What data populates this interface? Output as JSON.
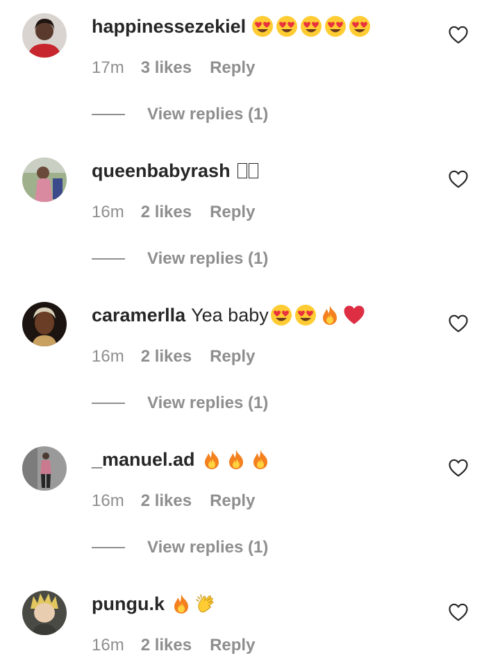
{
  "comments": [
    {
      "username": "happinessezekiel",
      "message": "",
      "emoji": [
        "heart-eyes",
        "heart-eyes",
        "heart-eyes",
        "heart-eyes",
        "heart-eyes"
      ],
      "time": "17m",
      "likes": "3 likes",
      "reply": "Reply",
      "view_replies": "View replies (1)",
      "avatar_color": "#b23a3a"
    },
    {
      "username": "queenbabyrash",
      "message": "",
      "emoji": [
        "missing-glyph",
        "missing-glyph"
      ],
      "time": "16m",
      "likes": "2 likes",
      "reply": "Reply",
      "view_replies": "View replies (1)",
      "avatar_color": "#8a9a7a"
    },
    {
      "username": "caramerlla",
      "message": "Yea baby",
      "emoji": [
        "heart-eyes",
        "heart-eyes",
        "fire",
        "red-heart"
      ],
      "time": "16m",
      "likes": "2 likes",
      "reply": "Reply",
      "view_replies": "View replies (1)",
      "avatar_color": "#3a2a22"
    },
    {
      "username": "_manuel.ad",
      "message": "",
      "emoji": [
        "fire",
        "fire",
        "fire"
      ],
      "time": "16m",
      "likes": "2 likes",
      "reply": "Reply",
      "view_replies": "View replies (1)",
      "avatar_color": "#8c8c8c"
    },
    {
      "username": "pungu.k",
      "message": "",
      "emoji": [
        "fire",
        "clapping-hands"
      ],
      "time": "16m",
      "likes": "2 likes",
      "reply": "Reply",
      "view_replies": "",
      "avatar_color": "#5a5a52"
    }
  ],
  "icons": {
    "like": "heart-outline-icon"
  },
  "colors": {
    "text": "#262626",
    "secondary_text": "#8e8e8e",
    "background": "#ffffff"
  }
}
